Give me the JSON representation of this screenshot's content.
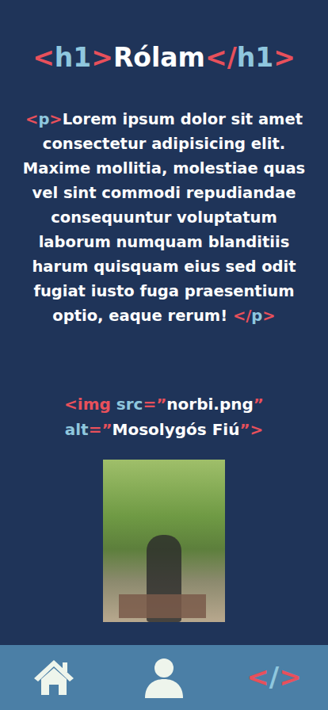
{
  "title": {
    "tokens": [
      {
        "text": "<",
        "kind": "punct"
      },
      {
        "text": "h1",
        "kind": "tag"
      },
      {
        "text": ">",
        "kind": "punct"
      },
      {
        "text": "Rólam",
        "kind": "text"
      },
      {
        "text": "</",
        "kind": "punct"
      },
      {
        "text": "h1",
        "kind": "tag"
      },
      {
        "text": ">",
        "kind": "punct"
      }
    ]
  },
  "paragraph": {
    "tokens": [
      {
        "text": "<",
        "kind": "punct"
      },
      {
        "text": "p",
        "kind": "tag"
      },
      {
        "text": ">",
        "kind": "punct"
      },
      {
        "text": "Lorem ipsum dolor sit amet consectetur adipisicing elit. Maxime mollitia, molestiae quas vel sint commodi repudiandae consequuntur voluptatum laborum numquam blanditiis harum quisquam eius sed odit fugiat iusto fuga praesentium optio, eaque rerum! ",
        "kind": "text"
      },
      {
        "text": "</",
        "kind": "punct"
      },
      {
        "text": "p",
        "kind": "tag"
      },
      {
        "text": ">",
        "kind": "punct"
      }
    ]
  },
  "image_code": {
    "lines": [
      {
        "tokens": [
          {
            "text": "<img ",
            "kind": "punct"
          },
          {
            "text": "src",
            "kind": "tag"
          },
          {
            "text": "=”",
            "kind": "punct"
          },
          {
            "text": "norbi.png",
            "kind": "text"
          },
          {
            "text": "”",
            "kind": "punct"
          }
        ]
      },
      {
        "tokens": [
          {
            "text": "alt",
            "kind": "tag"
          },
          {
            "text": "=”",
            "kind": "punct"
          },
          {
            "text": "Mosolygós Fiú",
            "kind": "text"
          },
          {
            "text": "”>",
            "kind": "punct"
          }
        ]
      }
    ]
  },
  "nav": {
    "code": {
      "tokens": [
        {
          "text": "<",
          "kind": "punct"
        },
        {
          "text": "/",
          "kind": "tag"
        },
        {
          "text": ">",
          "kind": "punct"
        }
      ]
    }
  }
}
